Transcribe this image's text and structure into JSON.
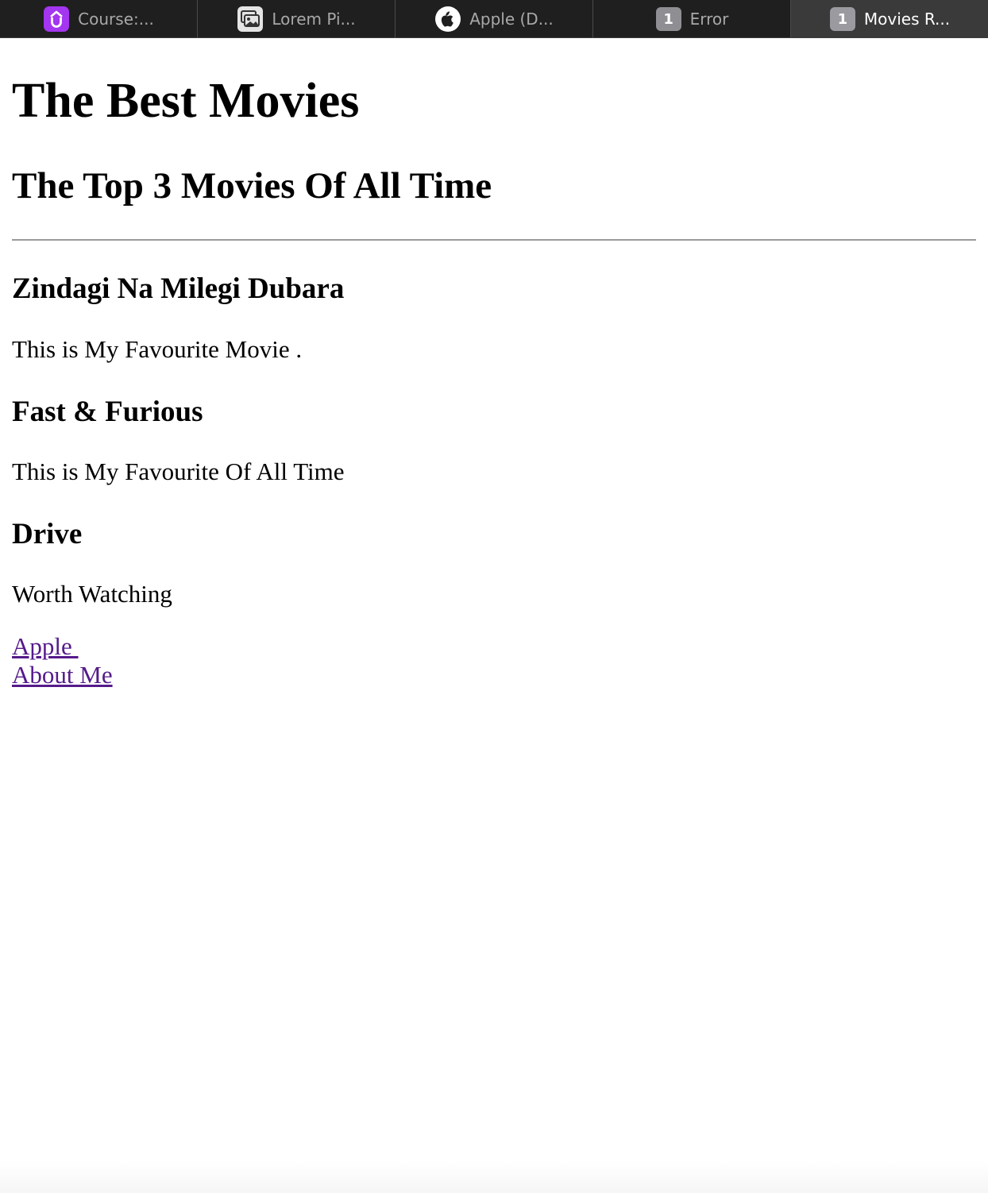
{
  "tabs": [
    {
      "title": "Course:...",
      "icon": "udemy-logo-icon",
      "icon_color": "#a435f0",
      "active": false
    },
    {
      "title": "Lorem Pi...",
      "icon": "image-gallery-icon",
      "active": false
    },
    {
      "title": "Apple (D...",
      "icon": "apple-logo-icon",
      "active": false
    },
    {
      "title": "Error",
      "icon": "number-badge",
      "badge": "1",
      "active": false
    },
    {
      "title": "Movies R...",
      "icon": "number-badge",
      "badge": "1",
      "active": true
    }
  ],
  "page": {
    "title": "The Best Movies",
    "subtitle": "The Top 3 Movies Of All Time",
    "movies": [
      {
        "name": "Zindagi Na Milegi Dubara",
        "description": "This is My Favourite Movie ."
      },
      {
        "name": "Fast & Furious",
        "description": "This is My Favourite Of All Time"
      },
      {
        "name": "Drive",
        "description": "Worth Watching"
      }
    ],
    "links": [
      {
        "label": "Apple "
      },
      {
        "label": "About Me"
      }
    ]
  },
  "colors": {
    "tabbar_bg": "#1f1f1f",
    "active_tab_bg": "#3a3a3a",
    "visited_link": "#551a8b"
  }
}
